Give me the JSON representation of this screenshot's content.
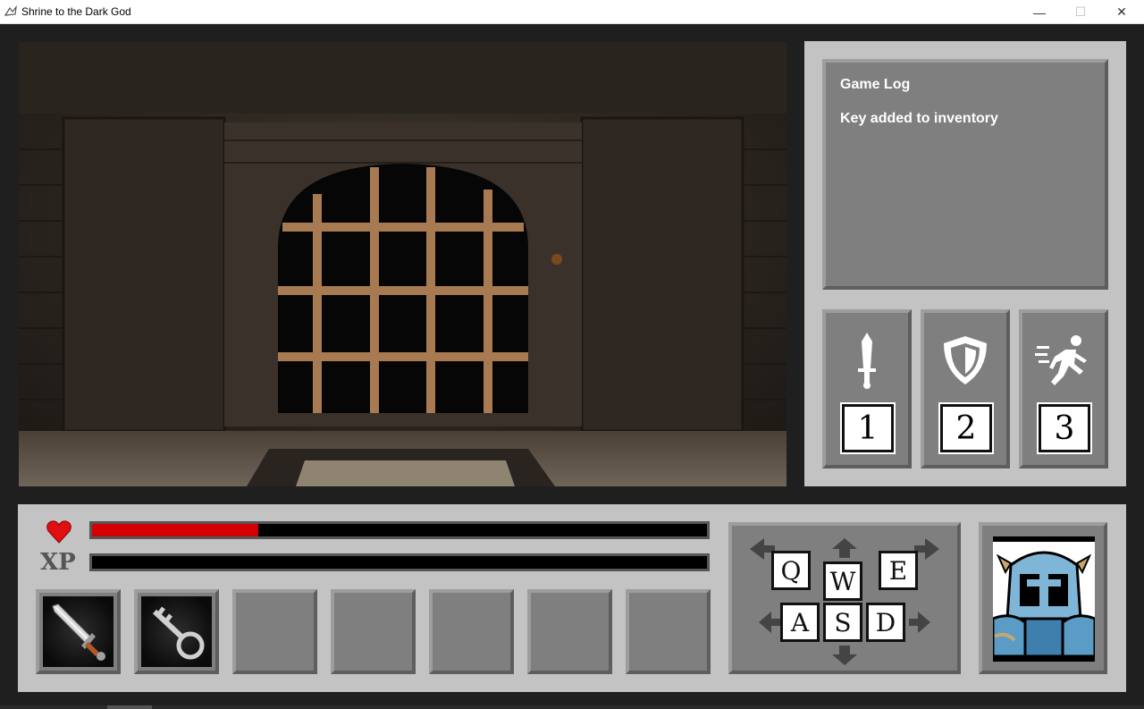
{
  "window": {
    "title": "Shrine to the Dark God",
    "controls": {
      "minimize": "—",
      "maximize": "☐",
      "close": "✕"
    }
  },
  "game_log": {
    "title": "Game Log",
    "messages": [
      "Key added to inventory"
    ]
  },
  "actions": [
    {
      "key": "1",
      "icon": "sword-icon"
    },
    {
      "key": "2",
      "icon": "shield-icon"
    },
    {
      "key": "3",
      "icon": "running-man-icon"
    }
  ],
  "stats": {
    "xp_label": "XP",
    "health_fraction": 0.27,
    "xp_fraction": 0.0,
    "health_color": "#d40000"
  },
  "inventory": [
    {
      "item": "sword-icon"
    },
    {
      "item": "key-icon"
    },
    {
      "item": ""
    },
    {
      "item": ""
    },
    {
      "item": ""
    },
    {
      "item": ""
    },
    {
      "item": ""
    }
  ],
  "movement_keys": {
    "q": "Q",
    "w": "W",
    "e": "E",
    "a": "A",
    "s": "S",
    "d": "D"
  },
  "portrait": {
    "icon": "knight-portrait-icon"
  },
  "colors": {
    "panel": "#c3c3c3",
    "slot": "#7f7f7f",
    "portcullis": "#a87a52"
  }
}
